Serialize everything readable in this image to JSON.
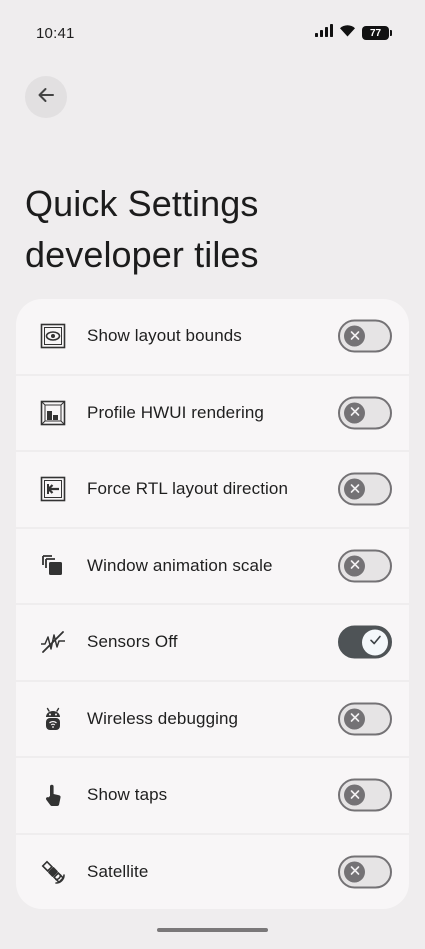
{
  "status_bar": {
    "time": "10:41",
    "battery_level": "77",
    "icons": [
      "signal-icon",
      "wifi-icon",
      "battery-icon"
    ]
  },
  "header": {
    "back_icon": "arrow-back-icon",
    "title_line1": "Quick Settings",
    "title_line2": "developer tiles"
  },
  "tiles": [
    {
      "label": "Show layout bounds",
      "icon": "layout-bounds-icon",
      "enabled": false
    },
    {
      "label": "Profile HWUI rendering",
      "icon": "hwui-profile-icon",
      "enabled": false
    },
    {
      "label": "Force RTL layout direction",
      "icon": "rtl-direction-icon",
      "enabled": false
    },
    {
      "label": "Window animation scale",
      "icon": "window-animation-icon",
      "enabled": false
    },
    {
      "label": "Sensors Off",
      "icon": "sensors-off-icon",
      "enabled": true
    },
    {
      "label": "Wireless debugging",
      "icon": "wireless-debugging-icon",
      "enabled": false
    },
    {
      "label": "Show taps",
      "icon": "touch-icon",
      "enabled": false
    },
    {
      "label": "Satellite",
      "icon": "satellite-icon",
      "enabled": false
    }
  ],
  "colors": {
    "background": "#efedee",
    "card": "#f8f6f7",
    "switch_off_track": "#e6e4e5",
    "switch_off_thumb": "#747275",
    "switch_on_track": "#4e5356",
    "switch_on_thumb": "#f4f8fb"
  }
}
